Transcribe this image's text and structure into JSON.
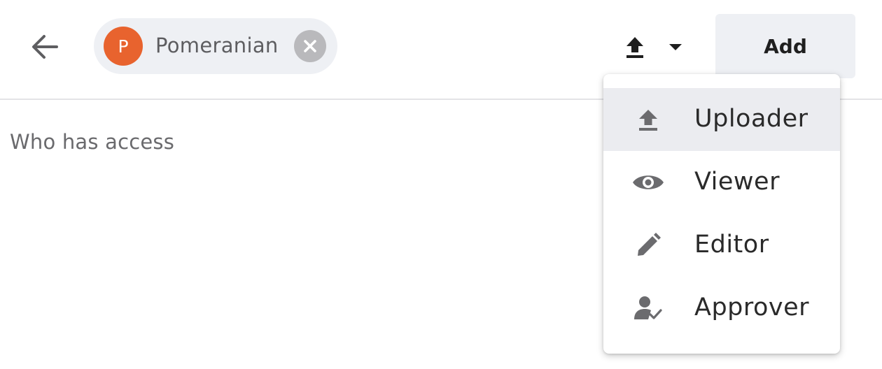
{
  "header": {
    "back_icon": "arrow-left-icon",
    "chip": {
      "avatar_initial": "P",
      "avatar_color": "#e8632e",
      "name": "Pomeranian",
      "remove_icon": "close-circle-icon"
    },
    "role_toggle": {
      "icon": "upload-icon",
      "caret_icon": "caret-down-icon"
    },
    "add_label": "Add"
  },
  "main": {
    "section_title": "Who has access"
  },
  "role_menu": {
    "items": [
      {
        "label": "Uploader",
        "icon": "upload-icon",
        "selected": true
      },
      {
        "label": "Viewer",
        "icon": "eye-icon",
        "selected": false
      },
      {
        "label": "Editor",
        "icon": "pencil-icon",
        "selected": false
      },
      {
        "label": "Approver",
        "icon": "person-check-icon",
        "selected": false
      }
    ]
  }
}
